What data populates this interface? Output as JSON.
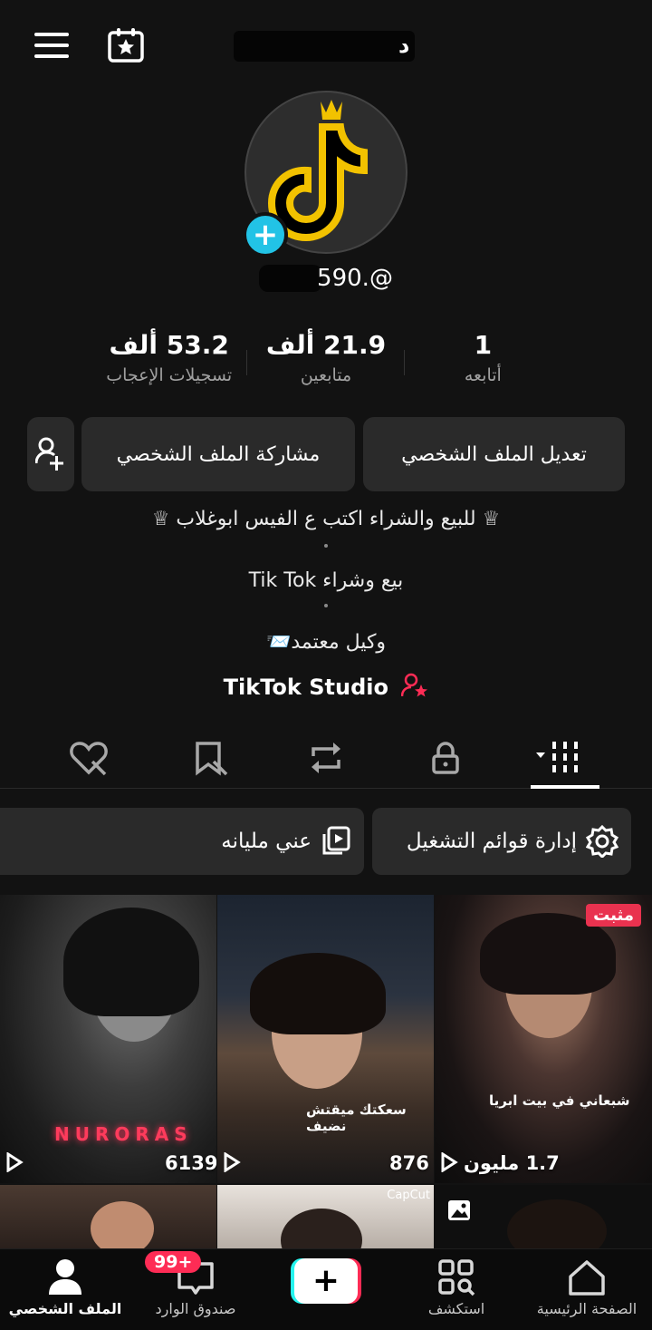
{
  "header": {
    "username_suffix": "د",
    "menu_icon": "menu-icon",
    "calendar_icon": "calendar-star-icon"
  },
  "profile": {
    "handle": "590.@",
    "stats": [
      {
        "value": "1",
        "label": "أتابعه"
      },
      {
        "value": "21.9 ألف",
        "label": "متابعين"
      },
      {
        "value": "53.2 ألف",
        "label": "تسجيلات الإعجاب"
      }
    ],
    "buttons": {
      "edit": "تعديل الملف الشخصي",
      "share": "مشاركة الملف الشخصي"
    },
    "bio": [
      "♕ للبيع والشراء اكتب ع الفيس ابوغلاب ♕",
      "بيع وشراء Tik Tok",
      "وكيل معتمد📨"
    ],
    "studio_link": "TikTok Studio"
  },
  "tabs": [
    "videos-grid",
    "private",
    "reposts",
    "favorites",
    "liked"
  ],
  "playlists": {
    "manage": "إدارة قوائم التشغيل",
    "about": "عني مليانه"
  },
  "videos": [
    {
      "views": "1.7 مليون",
      "pinned": "مثبت",
      "caption": "شبعاني في بيت ابريا"
    },
    {
      "views": "876",
      "caption": "سعكتك ميقتش نضيف"
    },
    {
      "views": "6139",
      "caption": "NURORAS"
    }
  ],
  "second_row": {
    "capcut": "CapCut"
  },
  "bottom_nav": {
    "home": "الصفحة الرئيسية",
    "discover": "استكشف",
    "inbox": "صندوق الوارد",
    "profile": "الملف الشخصي",
    "inbox_badge": "99+"
  },
  "colors": {
    "background": "#121212",
    "button": "#2a2a2a",
    "accent_red": "#fe2c55",
    "accent_cyan": "#25f4ee",
    "avatar_plus": "#22c3e6",
    "pinned_badge": "#e9324f"
  }
}
